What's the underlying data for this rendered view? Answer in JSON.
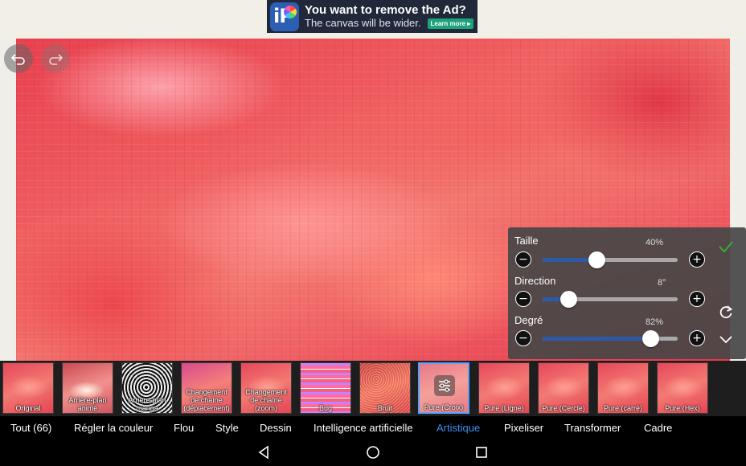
{
  "ad": {
    "title": "You want to remove the Ad?",
    "subtitle": "The canvas will be wider.",
    "learn_more": "Learn more ▸",
    "logo_text": "iP"
  },
  "canvas": {
    "undo_icon": "undo-icon",
    "redo_icon": "redo-icon"
  },
  "panel": {
    "params": [
      {
        "label": "Taille",
        "value": "40%",
        "fraction": 0.4
      },
      {
        "label": "Direction",
        "value": "8°",
        "fraction": 0.19
      },
      {
        "label": "Degré",
        "value": "82%",
        "fraction": 0.8
      }
    ],
    "minus": "−",
    "plus": "+",
    "accent": "#2c5aa6",
    "confirm_color": "#3aaa35"
  },
  "filters": [
    {
      "name": "Original"
    },
    {
      "name": "Arrière-plan animé"
    },
    {
      "name": "Arrière-plan manga"
    },
    {
      "name": "Changement de chaîne (déplacement)"
    },
    {
      "name": "Changement de chaîne (zoom)"
    },
    {
      "name": "Bug"
    },
    {
      "name": "Bruit"
    },
    {
      "name": "Pure (Croix)",
      "selected": true
    },
    {
      "name": "Pure (Ligne)"
    },
    {
      "name": "Pure (Cercle)"
    },
    {
      "name": "Pure (carré)"
    },
    {
      "name": "Pure (Hex)"
    }
  ],
  "categories": [
    {
      "label": "Tout (66)"
    },
    {
      "label": "Régler la couleur"
    },
    {
      "label": "Flou"
    },
    {
      "label": "Style"
    },
    {
      "label": "Dessin"
    },
    {
      "label": "Intelligence artificielle"
    },
    {
      "label": "Artistique",
      "active": true
    },
    {
      "label": "Pixeliser"
    },
    {
      "label": "Transformer"
    },
    {
      "label": "Cadre"
    }
  ],
  "active_category_color": "#3d8ff0"
}
